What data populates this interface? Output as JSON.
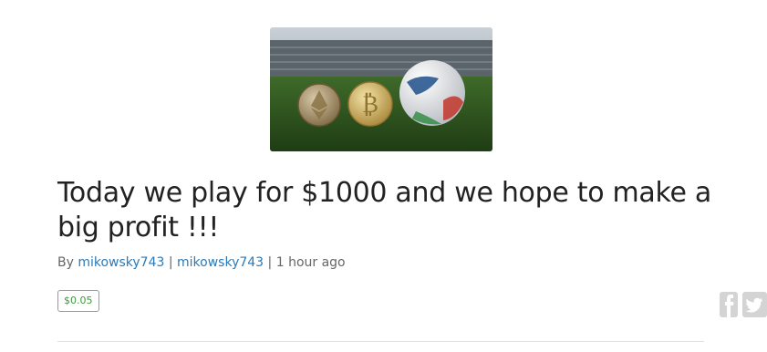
{
  "post": {
    "title": "Today we play for $1000 and we hope to make a big profit !!!",
    "byline": {
      "prefix": "By",
      "author": "mikowsky743",
      "community": "mikowsky743",
      "separator": "|",
      "time": "1 hour ago"
    },
    "payout": "$0.05"
  },
  "share": {
    "facebook_icon": "facebook-icon",
    "twitter_icon": "twitter-icon"
  },
  "colors": {
    "link": "#2a7ab9",
    "payout": "#3a9a3a",
    "text": "#222222",
    "muted": "#666666"
  }
}
